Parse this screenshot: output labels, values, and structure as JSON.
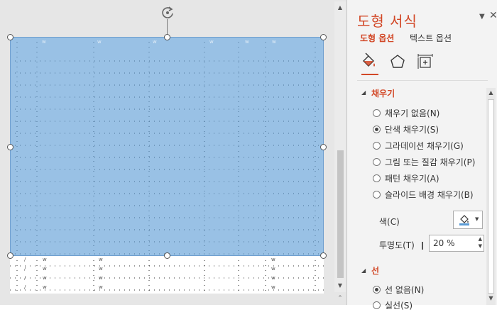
{
  "slide": {
    "header_faint": [
      "w",
      "w",
      "w",
      "w",
      "w",
      "w"
    ],
    "rows": [
      [
        "/",
        "w",
        "w",
        "",
        "",
        "w"
      ],
      [
        "/",
        "w",
        "w",
        "",
        "",
        "w"
      ],
      [
        "/",
        "w",
        "w",
        "",
        "",
        "w"
      ],
      [
        "/",
        "w",
        "w",
        "",
        "",
        "w"
      ]
    ]
  },
  "pane": {
    "title": "도형 서식",
    "tabs": {
      "shape_options": "도형 옵션",
      "text_options": "텍스트 옵션"
    },
    "fill_section": {
      "label": "채우기",
      "options": [
        {
          "label": "채우기 없음(N)",
          "selected": false
        },
        {
          "label": "단색 채우기(S)",
          "selected": true
        },
        {
          "label": "그라데이션 채우기(G)",
          "selected": false
        },
        {
          "label": "그림 또는 질감 채우기(P)",
          "selected": false
        },
        {
          "label": "패턴 채우기(A)",
          "selected": false
        },
        {
          "label": "슬라이드 배경 채우기(B)",
          "selected": false
        }
      ],
      "color_label": "색(C)",
      "transparency_label": "투명도(T)",
      "transparency_value": "20 %"
    },
    "line_section": {
      "label": "선",
      "options": [
        {
          "label": "선 없음(N)",
          "selected": true
        },
        {
          "label": "실선(S)",
          "selected": false
        }
      ]
    }
  },
  "colors": {
    "accent": "#d24726",
    "shape_fill": "#5b9bd5",
    "fill_color_swatch": "#5b9bd5"
  },
  "icons": [
    "rotate-icon",
    "fill-line-icon",
    "effects-icon",
    "size-properties-icon",
    "paint-bucket-icon",
    "close-icon",
    "chevron-down-icon"
  ]
}
